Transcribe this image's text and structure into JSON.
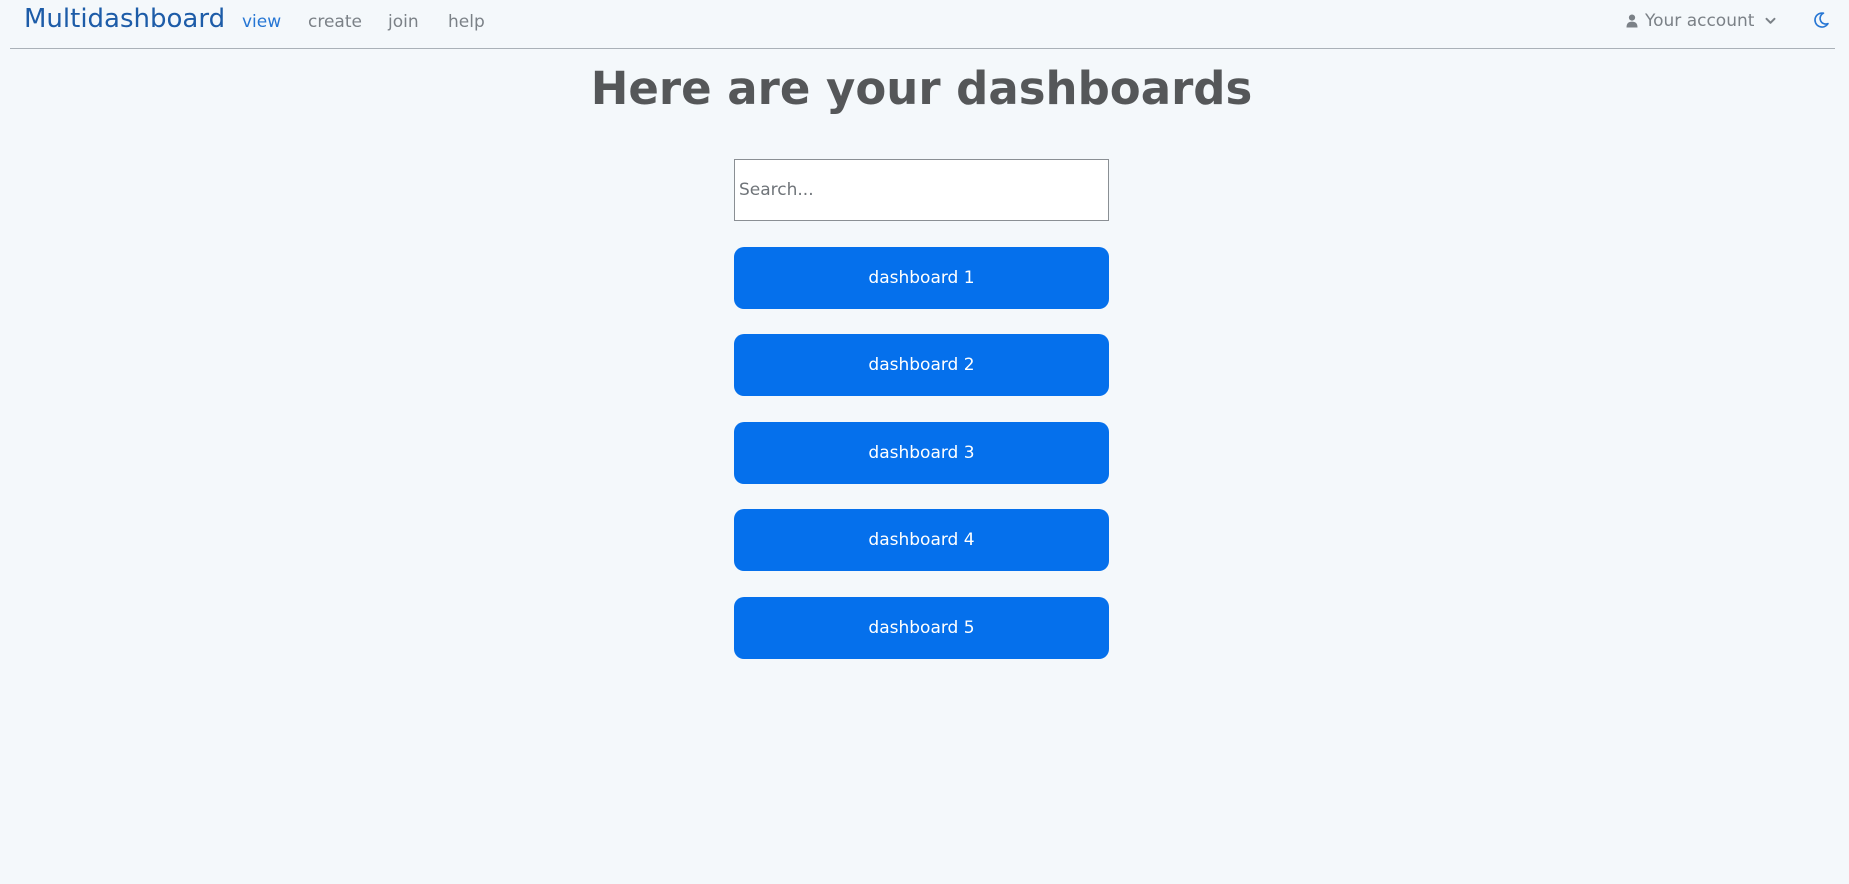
{
  "nav": {
    "brand": "Multidashboard",
    "links": [
      "view",
      "create",
      "join",
      "help"
    ],
    "active": "view",
    "account_label": "Your account"
  },
  "main": {
    "title": "Here are your dashboards",
    "search_placeholder": "Search...",
    "dashboards": [
      "dashboard 1",
      "dashboard 2",
      "dashboard 3",
      "dashboard 4",
      "dashboard 5"
    ]
  },
  "icons": {
    "account": "user-icon",
    "dropdown": "chevron-down-icon",
    "theme": "moon-icon"
  },
  "colors": {
    "brand": "#1d5ca8",
    "active_link": "#2676d4",
    "button": "#0570ec",
    "background": "#f4f8fb"
  }
}
